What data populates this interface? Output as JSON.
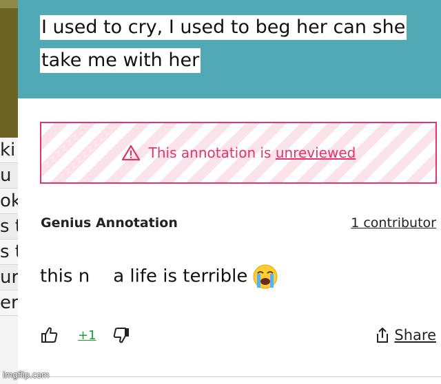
{
  "background_page": {
    "fragments": [
      "ki",
      "u h",
      "ok",
      "s t",
      "s t",
      "ure",
      "er"
    ]
  },
  "lyric": {
    "line1": "I used to cry, I used to beg her can she",
    "line2": "take me with her"
  },
  "warning": {
    "prefix": "This annotation is ",
    "link": "unreviewed",
    "icon": "warning-triangle-icon"
  },
  "annotation": {
    "source_label": "Genius Annotation",
    "contributors": "1 contributor",
    "text_before": "this n",
    "text_after": "a life is terrible",
    "emoji": "loudly-crying-face-icon"
  },
  "actions": {
    "upvote_icon": "thumbs-up-icon",
    "vote_count": "+1",
    "downvote_icon": "thumbs-down-icon",
    "share_icon": "share-icon",
    "share_label": "Share"
  },
  "watermark": "imgflip.com",
  "colors": {
    "header_teal": "#50a9b5",
    "warning_pink": "#e0346c",
    "vote_green": "#1a9e39"
  }
}
